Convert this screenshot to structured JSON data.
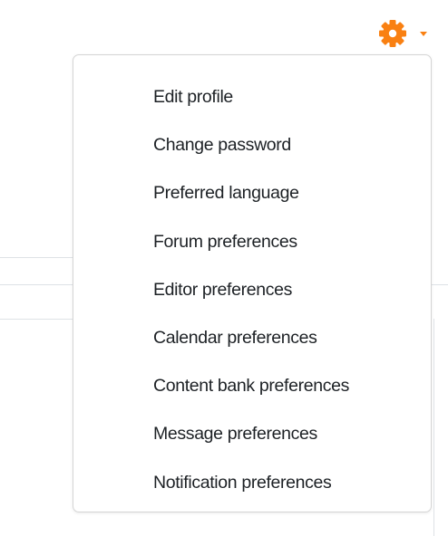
{
  "user_menu": {
    "toggle_icon": "gear-icon",
    "caret_icon": "caret-down-icon",
    "accent_color": "#f98012",
    "items": [
      {
        "label": "Edit profile"
      },
      {
        "label": "Change password"
      },
      {
        "label": "Preferred language"
      },
      {
        "label": "Forum preferences"
      },
      {
        "label": "Editor preferences"
      },
      {
        "label": "Calendar preferences"
      },
      {
        "label": "Content bank preferences"
      },
      {
        "label": "Message preferences"
      },
      {
        "label": "Notification preferences"
      }
    ]
  }
}
